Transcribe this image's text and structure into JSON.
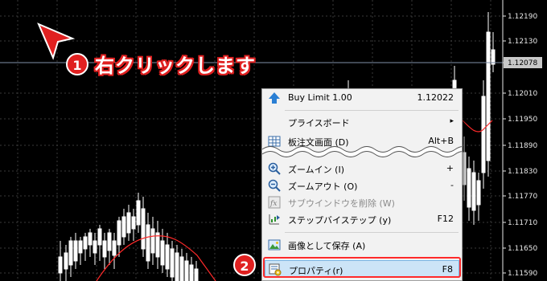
{
  "price_axis": {
    "labels": [
      "1.12190",
      "1.12130",
      "1.12078",
      "1.12010",
      "1.11950",
      "1.11890",
      "1.11830",
      "1.11770",
      "1.11710",
      "1.11650",
      "1.11590"
    ],
    "current_price": "1.12078"
  },
  "annotations": {
    "step1_number": "1",
    "step1_text": "右クリックします",
    "step2_number": "2"
  },
  "colors": {
    "bull": "#00ff00",
    "bear": "#ffffff",
    "moving_average": "#ff2a2a",
    "highlight_frame": "#ff2a2a",
    "badge": "#e02020"
  },
  "context_menu": {
    "items": [
      {
        "label": "Buy Limit 1.00",
        "shortcut": "1.12022",
        "icon": "up-arrow-icon",
        "disabled": false
      },
      {
        "label": "プライスボード",
        "shortcut": "▸",
        "icon": "",
        "disabled": false
      },
      {
        "label": "板注文画面 (D)",
        "shortcut": "Alt+B",
        "icon": "grid-icon",
        "disabled": false
      },
      {
        "label": "ズームイン (I)",
        "shortcut": "+",
        "icon": "zoom-in-icon",
        "disabled": false
      },
      {
        "label": "ズームアウト (O)",
        "shortcut": "-",
        "icon": "zoom-out-icon",
        "disabled": false
      },
      {
        "label": "サブウインドウを削除 (W)",
        "shortcut": "",
        "icon": "fx-icon",
        "disabled": true
      },
      {
        "label": "ステップバイステップ (y)",
        "shortcut": "F12",
        "icon": "step-icon",
        "disabled": false
      },
      {
        "label": "画像として保存 (A)",
        "shortcut": "",
        "icon": "image-icon",
        "disabled": false
      },
      {
        "label": "プロパティ(r)",
        "shortcut": "F8",
        "icon": "properties-icon",
        "disabled": false
      }
    ]
  }
}
